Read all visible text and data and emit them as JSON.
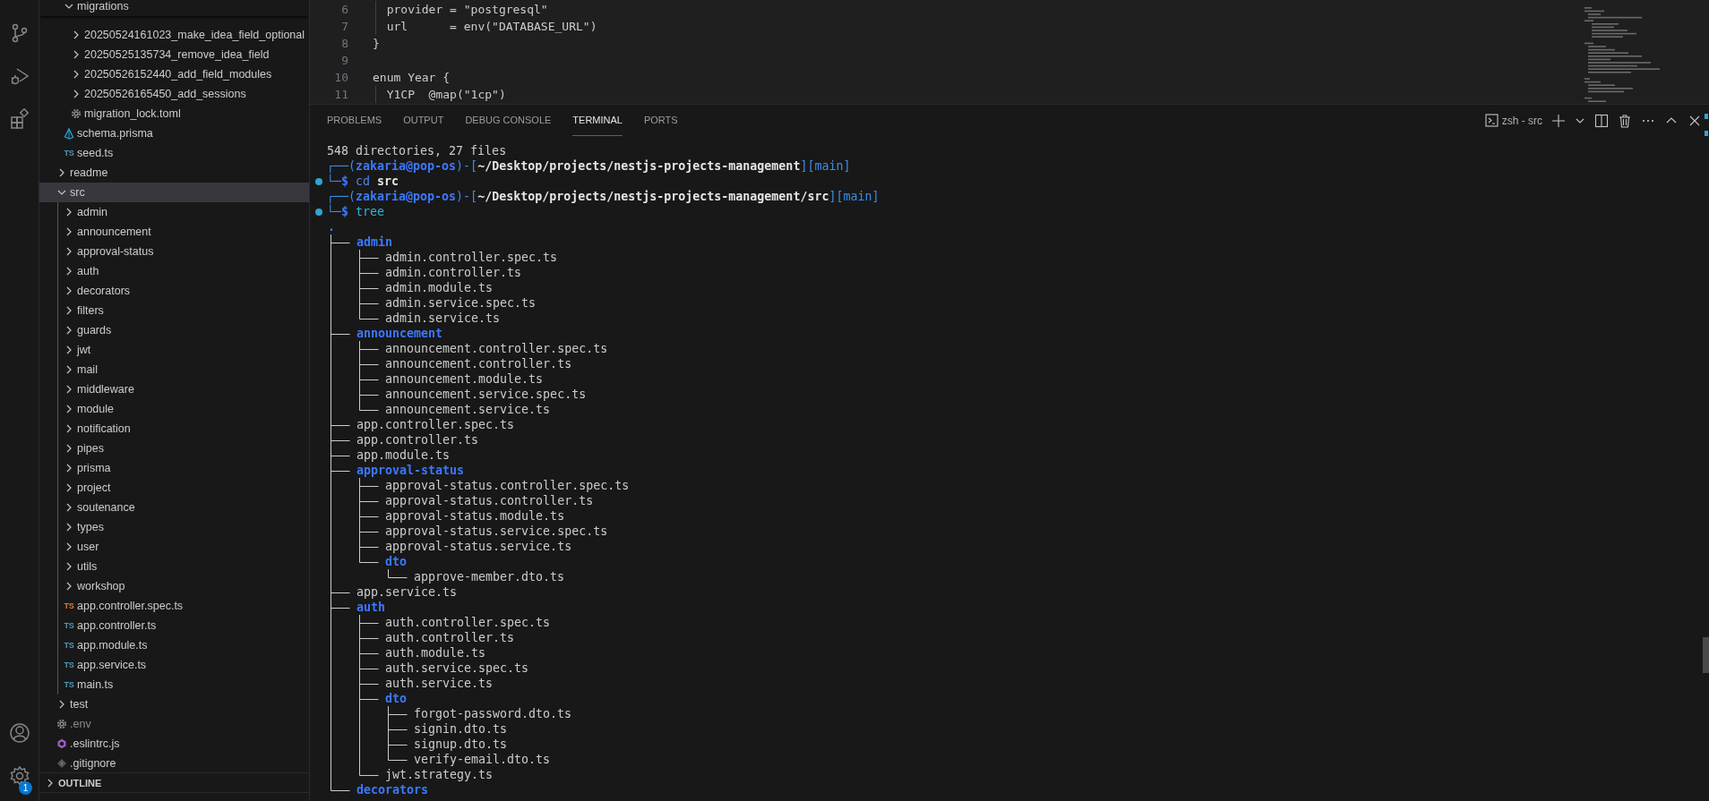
{
  "activity_bar": {
    "settings_badge": "1"
  },
  "explorer": {
    "items": [
      {
        "children": [
          {
            "name": "migrations",
            "kind": "folder",
            "expanded": true,
            "selected": false,
            "children": [
              {
                "name": "20250524161023_make_idea_field_optional",
                "kind": "folder",
                "expanded": false,
                "selected": false
              },
              {
                "name": "20250525135734_remove_idea_field",
                "kind": "folder",
                "expanded": false,
                "selected": false
              },
              {
                "name": "20250526152440_add_field_modules",
                "kind": "folder",
                "expanded": false,
                "selected": false
              },
              {
                "name": "20250526165450_add_sessions",
                "kind": "folder",
                "expanded": false,
                "selected": false
              },
              {
                "name": "migration_lock.toml",
                "kind": "settings-file",
                "selected": false,
                "dimmed": false
              }
            ]
          },
          {
            "name": "schema.prisma",
            "kind": "prisma-file",
            "selected": false,
            "dimmed": false
          },
          {
            "name": "seed.ts",
            "kind": "ts-file",
            "icon_text": "TS",
            "color": "#519aba",
            "selected": false,
            "dimmed": false
          }
        ]
      },
      {
        "name": "readme",
        "kind": "folder",
        "expanded": false,
        "selected": false
      },
      {
        "name": "src",
        "kind": "folder",
        "expanded": true,
        "selected": true,
        "children": [
          {
            "name": "admin",
            "kind": "folder",
            "expanded": false,
            "selected": false
          },
          {
            "name": "announcement",
            "kind": "folder",
            "expanded": false,
            "selected": false
          },
          {
            "name": "approval-status",
            "kind": "folder",
            "expanded": false,
            "selected": false
          },
          {
            "name": "auth",
            "kind": "folder",
            "expanded": false,
            "selected": false
          },
          {
            "name": "decorators",
            "kind": "folder",
            "expanded": false,
            "selected": false
          },
          {
            "name": "filters",
            "kind": "folder",
            "expanded": false,
            "selected": false
          },
          {
            "name": "guards",
            "kind": "folder",
            "expanded": false,
            "selected": false
          },
          {
            "name": "jwt",
            "kind": "folder",
            "expanded": false,
            "selected": false
          },
          {
            "name": "mail",
            "kind": "folder",
            "expanded": false,
            "selected": false
          },
          {
            "name": "middleware",
            "kind": "folder",
            "expanded": false,
            "selected": false
          },
          {
            "name": "module",
            "kind": "folder",
            "expanded": false,
            "selected": false
          },
          {
            "name": "notification",
            "kind": "folder",
            "expanded": false,
            "selected": false
          },
          {
            "name": "pipes",
            "kind": "folder",
            "expanded": false,
            "selected": false
          },
          {
            "name": "prisma",
            "kind": "folder",
            "expanded": false,
            "selected": false
          },
          {
            "name": "project",
            "kind": "folder",
            "expanded": false,
            "selected": false
          },
          {
            "name": "soutenance",
            "kind": "folder",
            "expanded": false,
            "selected": false
          },
          {
            "name": "types",
            "kind": "folder",
            "expanded": false,
            "selected": false
          },
          {
            "name": "user",
            "kind": "folder",
            "expanded": false,
            "selected": false
          },
          {
            "name": "utils",
            "kind": "folder",
            "expanded": false,
            "selected": false
          },
          {
            "name": "workshop",
            "kind": "folder",
            "expanded": false,
            "selected": false
          },
          {
            "name": "app.controller.spec.ts",
            "kind": "ts-file",
            "icon_text": "TS",
            "color": "#e37933",
            "selected": false,
            "dimmed": false
          },
          {
            "name": "app.controller.ts",
            "kind": "ts-file",
            "icon_text": "TS",
            "color": "#519aba",
            "selected": false,
            "dimmed": false
          },
          {
            "name": "app.module.ts",
            "kind": "ts-file",
            "icon_text": "TS",
            "color": "#519aba",
            "selected": false,
            "dimmed": false
          },
          {
            "name": "app.service.ts",
            "kind": "ts-file",
            "icon_text": "TS",
            "color": "#519aba",
            "selected": false,
            "dimmed": false
          },
          {
            "name": "main.ts",
            "kind": "ts-file",
            "icon_text": "TS",
            "color": "#519aba",
            "selected": false,
            "dimmed": false
          }
        ]
      },
      {
        "name": "test",
        "kind": "folder",
        "expanded": false,
        "selected": false
      },
      {
        "name": ".env",
        "kind": "settings-file",
        "selected": false,
        "dimmed": true
      },
      {
        "name": ".eslintrc.js",
        "kind": "eslint-file",
        "selected": false,
        "dimmed": false
      },
      {
        "name": ".gitignore",
        "kind": "git-file",
        "selected": false,
        "dimmed": false
      }
    ],
    "sections": [
      {
        "title": "OUTLINE",
        "expanded": false
      }
    ]
  },
  "editor": {
    "lines": [
      {
        "number": "6",
        "code": "  provider = \"postgresql\"",
        "guide": true
      },
      {
        "number": "7",
        "code": "  url      = env(\"DATABASE_URL\")",
        "guide": true
      },
      {
        "number": "8",
        "code": "}",
        "guide": false
      },
      {
        "number": "9",
        "guide": false
      },
      {
        "number": "10",
        "code": "enum Year {",
        "guide": false
      },
      {
        "number": "11",
        "code": "  Y1CP  @map(\"1cp\")",
        "guide": true
      }
    ]
  },
  "panel": {
    "tabs": [
      {
        "label": "PROBLEMS",
        "selected": false
      },
      {
        "label": "OUTPUT",
        "selected": false
      },
      {
        "label": "DEBUG CONSOLE",
        "selected": false
      },
      {
        "label": "TERMINAL",
        "selected": true
      },
      {
        "label": "PORTS",
        "selected": false
      }
    ],
    "terminal_name": "zsh - src",
    "terminal": {
      "lines": [
        {
          "marked": false,
          "segments": [
            {
              "kind": "plain",
              "text": "548 directories, 27 files"
            }
          ]
        },
        {
          "marked": false,
          "segments": [
            {
              "kind": "frame",
              "text": "┌──("
            },
            {
              "kind": "user",
              "text": "zakaria@pop-os"
            },
            {
              "kind": "frame",
              "text": ")-["
            },
            {
              "kind": "path",
              "text": "~/Desktop/projects/nestjs-projects-management"
            },
            {
              "kind": "frame",
              "text": "]"
            },
            {
              "kind": "branch",
              "text": "[main]"
            }
          ]
        },
        {
          "marked": true,
          "segments": [
            {
              "kind": "frame",
              "text": "└─"
            },
            {
              "kind": "prompt",
              "text": "$"
            },
            {
              "kind": "builtin",
              "text": " cd"
            },
            {
              "kind": "arg",
              "text": " src"
            }
          ]
        },
        {
          "marked": false,
          "segments": [
            {
              "kind": "frame",
              "text": "┌──("
            },
            {
              "kind": "user",
              "text": "zakaria@pop-os"
            },
            {
              "kind": "frame",
              "text": ")-["
            },
            {
              "kind": "path",
              "text": "~/Desktop/projects/nestjs-projects-management/src"
            },
            {
              "kind": "frame",
              "text": "]"
            },
            {
              "kind": "branch",
              "text": "[main]"
            }
          ]
        },
        {
          "marked": true,
          "segments": [
            {
              "kind": "frame",
              "text": "└─"
            },
            {
              "kind": "prompt",
              "text": "$"
            },
            {
              "kind": "command",
              "text": " tree"
            }
          ]
        }
      ],
      "tree": {
        "name": ".",
        "kind": "dir",
        "children": [
          {
            "name": "admin",
            "kind": "dir",
            "children": [
              {
                "name": "admin.controller.spec.ts",
                "kind": "file"
              },
              {
                "name": "admin.controller.ts",
                "kind": "file"
              },
              {
                "name": "admin.module.ts",
                "kind": "file"
              },
              {
                "name": "admin.service.spec.ts",
                "kind": "file"
              },
              {
                "name": "admin.service.ts",
                "kind": "file"
              }
            ]
          },
          {
            "name": "announcement",
            "kind": "dir",
            "children": [
              {
                "name": "announcement.controller.spec.ts",
                "kind": "file"
              },
              {
                "name": "announcement.controller.ts",
                "kind": "file"
              },
              {
                "name": "announcement.module.ts",
                "kind": "file"
              },
              {
                "name": "announcement.service.spec.ts",
                "kind": "file"
              },
              {
                "name": "announcement.service.ts",
                "kind": "file"
              }
            ]
          },
          {
            "name": "app.controller.spec.ts",
            "kind": "file"
          },
          {
            "name": "app.controller.ts",
            "kind": "file"
          },
          {
            "name": "app.module.ts",
            "kind": "file"
          },
          {
            "name": "approval-status",
            "kind": "dir",
            "children": [
              {
                "name": "approval-status.controller.spec.ts",
                "kind": "file"
              },
              {
                "name": "approval-status.controller.ts",
                "kind": "file"
              },
              {
                "name": "approval-status.module.ts",
                "kind": "file"
              },
              {
                "name": "approval-status.service.spec.ts",
                "kind": "file"
              },
              {
                "name": "approval-status.service.ts",
                "kind": "file"
              },
              {
                "name": "dto",
                "kind": "dir",
                "children": [
                  {
                    "name": "approve-member.dto.ts",
                    "kind": "file"
                  }
                ]
              }
            ]
          },
          {
            "name": "app.service.ts",
            "kind": "file"
          },
          {
            "name": "auth",
            "kind": "dir",
            "children": [
              {
                "name": "auth.controller.spec.ts",
                "kind": "file"
              },
              {
                "name": "auth.controller.ts",
                "kind": "file"
              },
              {
                "name": "auth.module.ts",
                "kind": "file"
              },
              {
                "name": "auth.service.spec.ts",
                "kind": "file"
              },
              {
                "name": "auth.service.ts",
                "kind": "file"
              },
              {
                "name": "dto",
                "kind": "dir",
                "children": [
                  {
                    "name": "forgot-password.dto.ts",
                    "kind": "file"
                  },
                  {
                    "name": "signin.dto.ts",
                    "kind": "file"
                  },
                  {
                    "name": "signup.dto.ts",
                    "kind": "file"
                  },
                  {
                    "name": "verify-email.dto.ts",
                    "kind": "file"
                  }
                ]
              },
              {
                "name": "jwt.strategy.ts",
                "kind": "file"
              }
            ]
          },
          {
            "name": "decorators",
            "kind": "dir"
          }
        ]
      }
    }
  }
}
